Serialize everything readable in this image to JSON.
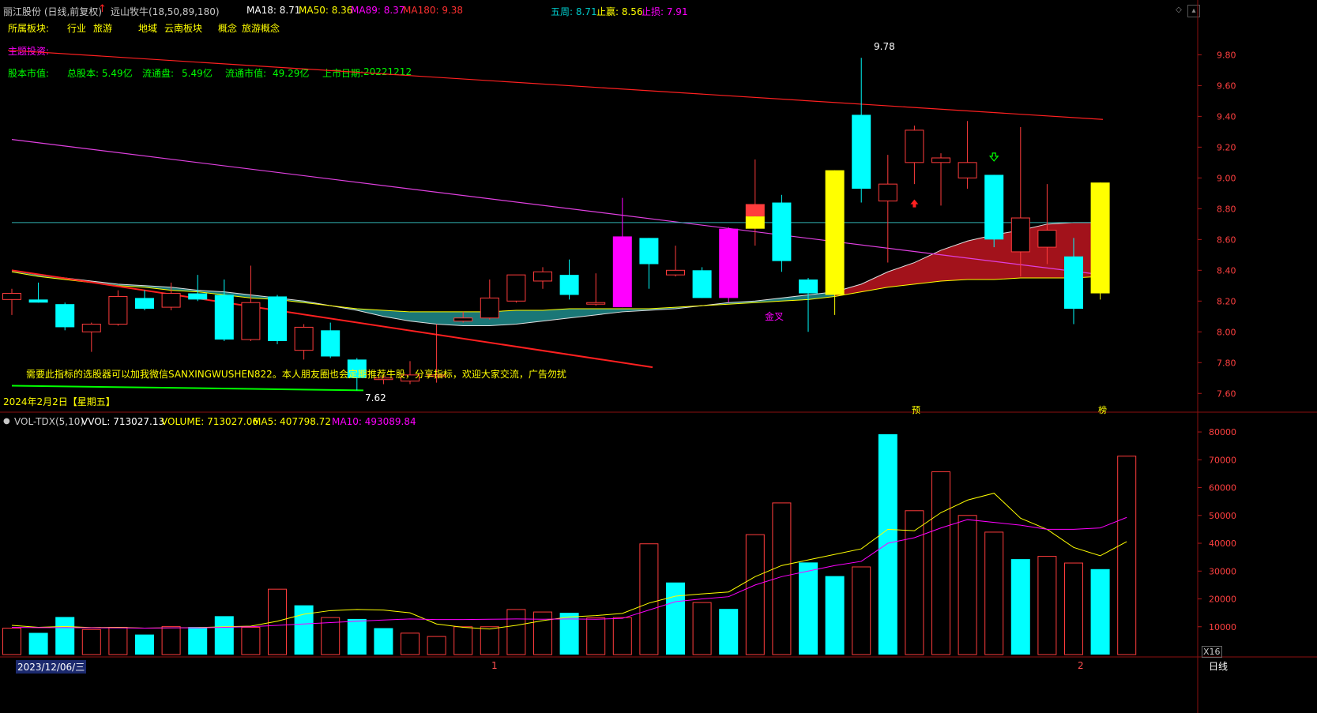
{
  "header": {
    "stock": "丽江股份 (日线,前复权)",
    "indicator": "远山牧牛(18,50,89,180)",
    "ma18": "MA18: 8.71",
    "ma50": "MA50: 8.36",
    "ma89": "MA89: 8.37",
    "ma180": "MA180: 9.38",
    "wuzhou": "五周: 8.71",
    "zhiying": "止赢: 8.56",
    "zhisun": "止损: 7.91"
  },
  "info": {
    "sector_label": "所属板块:",
    "industry_label": "行业",
    "industry": "旅游",
    "region_label": "地域",
    "region": "云南板块",
    "concept_label": "概念",
    "concept": "旅游概念",
    "theme_label": "主题投资:",
    "equity_label": "股本市值:",
    "total_shares": "总股本: 5.49亿",
    "float_shares_label": "流通盘:",
    "float_shares": "5.49亿",
    "float_cap_label": "流通市值:",
    "float_cap": "49.29亿",
    "listing_label": "上市日期:",
    "listing_date": "20221212"
  },
  "annotations": {
    "ad_text": "需要此指标的选股器可以加我微信SANXINGWUSHEN822。本人朋友圈也会定期推荐牛股，分享指标，欢迎大家交流，广告勿扰",
    "golden_cross": "金叉",
    "high_label": "9.78",
    "low_label": "7.62",
    "date_label": "2024年2月2日【星期五】",
    "marker_yu": "预",
    "marker_bang": "榜"
  },
  "volume_header": {
    "name": "VOL-TDX(5,10)",
    "vvol": "VVOL: 713027.13",
    "volume": "VOLUME: 713027.06",
    "ma5": "MA5: 407798.72",
    "ma10": "MA10: 493089.84"
  },
  "footer": {
    "start_date": "2023/12/06/三",
    "marker_1": "1",
    "marker_2": "2",
    "period": "日线",
    "zoom": "X16"
  },
  "colors": {
    "up": "#ff3c3c",
    "down": "#00ffff",
    "yellow": "#ffff00",
    "magenta": "#ff00ff",
    "band_up": "#b4141e",
    "band_down": "#1e8c8c"
  },
  "chart_data": [
    {
      "type": "candlestick",
      "title": "丽江股份 (日线,前复权)",
      "ylim": [
        7.55,
        9.92
      ],
      "yticks": [
        "9.80",
        "9.60",
        "9.40",
        "9.20",
        "9.00",
        "8.80",
        "8.60",
        "8.40",
        "8.20",
        "8.00",
        "7.80",
        "7.60"
      ],
      "ytick_values": [
        9.8,
        9.6,
        9.4,
        9.2,
        9.0,
        8.8,
        8.6,
        8.4,
        8.2,
        8.0,
        7.8,
        7.6
      ],
      "candles": [
        {
          "o": 8.21,
          "h": 8.28,
          "l": 8.11,
          "c": 8.25,
          "kind": "up"
        },
        {
          "o": 8.21,
          "h": 8.32,
          "l": 8.19,
          "c": 8.19,
          "kind": "down"
        },
        {
          "o": 8.18,
          "h": 8.19,
          "l": 8.01,
          "c": 8.03,
          "kind": "down"
        },
        {
          "o": 8.0,
          "h": 8.06,
          "l": 7.87,
          "c": 8.05,
          "kind": "up"
        },
        {
          "o": 8.05,
          "h": 8.27,
          "l": 8.04,
          "c": 8.23,
          "kind": "up"
        },
        {
          "o": 8.22,
          "h": 8.27,
          "l": 8.14,
          "c": 8.15,
          "kind": "down"
        },
        {
          "o": 8.16,
          "h": 8.32,
          "l": 8.14,
          "c": 8.25,
          "kind": "up"
        },
        {
          "o": 8.25,
          "h": 8.37,
          "l": 8.2,
          "c": 8.21,
          "kind": "down"
        },
        {
          "o": 8.24,
          "h": 8.34,
          "l": 7.94,
          "c": 7.95,
          "kind": "down"
        },
        {
          "o": 7.95,
          "h": 8.43,
          "l": 7.94,
          "c": 8.19,
          "kind": "up"
        },
        {
          "o": 8.23,
          "h": 8.24,
          "l": 7.92,
          "c": 7.94,
          "kind": "down"
        },
        {
          "o": 7.88,
          "h": 8.05,
          "l": 7.82,
          "c": 8.03,
          "kind": "up"
        },
        {
          "o": 8.01,
          "h": 8.06,
          "l": 7.83,
          "c": 7.84,
          "kind": "down"
        },
        {
          "o": 7.82,
          "h": 7.83,
          "l": 7.62,
          "c": 7.7,
          "kind": "down"
        },
        {
          "o": 7.69,
          "h": 7.72,
          "l": 7.66,
          "c": 7.7,
          "kind": "up"
        },
        {
          "o": 7.68,
          "h": 7.81,
          "l": 7.66,
          "c": 7.72,
          "kind": "up"
        },
        {
          "o": 7.71,
          "h": 8.05,
          "l": 7.67,
          "c": 7.72,
          "kind": "up"
        },
        {
          "o": 8.07,
          "h": 8.13,
          "l": 8.06,
          "c": 8.09,
          "kind": "up"
        },
        {
          "o": 8.09,
          "h": 8.34,
          "l": 8.08,
          "c": 8.22,
          "kind": "up"
        },
        {
          "o": 8.2,
          "h": 8.37,
          "l": 8.19,
          "c": 8.37,
          "kind": "up"
        },
        {
          "o": 8.33,
          "h": 8.42,
          "l": 8.28,
          "c": 8.39,
          "kind": "up"
        },
        {
          "o": 8.37,
          "h": 8.47,
          "l": 8.21,
          "c": 8.24,
          "kind": "down"
        },
        {
          "o": 8.18,
          "h": 8.38,
          "l": 8.17,
          "c": 8.19,
          "kind": "up"
        },
        {
          "o": 8.16,
          "h": 8.87,
          "l": 8.16,
          "c": 8.62,
          "kind": "magenta"
        },
        {
          "o": 8.61,
          "h": 8.61,
          "l": 8.28,
          "c": 8.44,
          "kind": "down"
        },
        {
          "o": 8.37,
          "h": 8.56,
          "l": 8.36,
          "c": 8.4,
          "kind": "up"
        },
        {
          "o": 8.4,
          "h": 8.42,
          "l": 8.22,
          "c": 8.22,
          "kind": "down"
        },
        {
          "o": 8.22,
          "h": 8.68,
          "l": 8.19,
          "c": 8.67,
          "kind": "magenta"
        },
        {
          "o": 8.67,
          "h": 9.12,
          "l": 8.56,
          "c": 8.83,
          "kind": "redyellow"
        },
        {
          "o": 8.84,
          "h": 8.89,
          "l": 8.39,
          "c": 8.46,
          "kind": "down"
        },
        {
          "o": 8.34,
          "h": 8.35,
          "l": 8.0,
          "c": 8.25,
          "kind": "down"
        },
        {
          "o": 8.24,
          "h": 9.05,
          "l": 8.11,
          "c": 9.05,
          "kind": "yellow"
        },
        {
          "o": 9.41,
          "h": 9.78,
          "l": 8.84,
          "c": 8.93,
          "kind": "down"
        },
        {
          "o": 8.85,
          "h": 9.15,
          "l": 8.45,
          "c": 8.96,
          "kind": "up"
        },
        {
          "o": 9.1,
          "h": 9.34,
          "l": 8.96,
          "c": 9.31,
          "kind": "up"
        },
        {
          "o": 9.1,
          "h": 9.16,
          "l": 8.82,
          "c": 9.13,
          "kind": "up"
        },
        {
          "o": 9.0,
          "h": 9.37,
          "l": 8.93,
          "c": 9.1,
          "kind": "up"
        },
        {
          "o": 9.02,
          "h": 9.02,
          "l": 8.55,
          "c": 8.6,
          "kind": "down"
        },
        {
          "o": 8.52,
          "h": 9.33,
          "l": 8.36,
          "c": 8.74,
          "kind": "up"
        },
        {
          "o": 8.66,
          "h": 8.96,
          "l": 8.44,
          "c": 8.55,
          "kind": "up"
        },
        {
          "o": 8.49,
          "h": 8.61,
          "l": 8.05,
          "c": 8.15,
          "kind": "down"
        },
        {
          "o": 8.25,
          "h": 8.97,
          "l": 8.21,
          "c": 8.97,
          "kind": "yellow"
        }
      ],
      "ma_long": [
        9.83,
        9.38
      ],
      "ma_mid": [
        9.25,
        8.37
      ],
      "flat_line": 8.71,
      "upper_band": [
        8.4,
        8.37,
        8.35,
        8.33,
        8.31,
        8.3,
        8.29,
        8.27,
        8.26,
        8.24,
        8.22,
        8.2,
        8.17,
        8.14,
        8.1,
        8.07,
        8.05,
        8.04,
        8.04,
        8.05,
        8.07,
        8.09,
        8.11,
        8.13,
        8.14,
        8.15,
        8.17,
        8.19,
        8.2,
        8.22,
        8.24,
        8.26,
        8.31,
        8.39,
        8.45,
        8.53,
        8.59,
        8.63,
        8.66,
        8.7,
        8.71,
        8.71
      ],
      "lower_band": [
        8.39,
        8.36,
        8.34,
        8.32,
        8.3,
        8.29,
        8.27,
        8.26,
        8.24,
        8.22,
        8.21,
        8.19,
        8.17,
        8.15,
        8.14,
        8.13,
        8.13,
        8.13,
        8.13,
        8.14,
        8.14,
        8.15,
        8.15,
        8.15,
        8.15,
        8.16,
        8.17,
        8.18,
        8.19,
        8.2,
        8.21,
        8.23,
        8.26,
        8.29,
        8.31,
        8.33,
        8.34,
        8.34,
        8.35,
        8.35,
        8.35,
        8.36
      ],
      "trend_red": [
        8.4,
        7.77
      ],
      "trend_green": [
        7.65,
        7.62
      ]
    },
    {
      "type": "bar",
      "title": "VOL-TDX(5,10)",
      "ylim": [
        0,
        82000
      ],
      "yticks": [
        "80000",
        "70000",
        "60000",
        "50000",
        "40000",
        "30000",
        "20000",
        "10000"
      ],
      "ytick_values": [
        80000,
        70000,
        60000,
        50000,
        40000,
        30000,
        20000,
        10000
      ],
      "values": [
        9500,
        7800,
        13500,
        9000,
        9800,
        7200,
        10100,
        9900,
        13800,
        9800,
        23500,
        17700,
        13300,
        12800,
        9500,
        7700,
        6500,
        10000,
        10000,
        16200,
        15300,
        15000,
        13200,
        13300,
        39800,
        25900,
        18700,
        16400,
        43100,
        54500,
        33100,
        28200,
        31500,
        79200,
        51700,
        65700,
        50000,
        44000,
        34300,
        35300,
        32900,
        30700,
        71300
      ],
      "kinds": [
        "up",
        "down",
        "down",
        "up",
        "up",
        "down",
        "up",
        "down",
        "down",
        "up",
        "up",
        "down",
        "up",
        "down",
        "down",
        "up",
        "up",
        "up",
        "up",
        "up",
        "up",
        "down",
        "up",
        "up",
        "up",
        "down",
        "up",
        "down",
        "up",
        "up",
        "down",
        "down",
        "up",
        "down",
        "up",
        "up",
        "up",
        "up",
        "down",
        "up",
        "up",
        "down",
        "up"
      ],
      "series": [
        {
          "name": "MA5",
          "values": [
            10500,
            9800,
            10100,
            9700,
            9800,
            9500,
            9600,
            9700,
            10000,
            10200,
            12000,
            14500,
            15800,
            16200,
            16000,
            15000,
            11000,
            9800,
            9200,
            10500,
            12200,
            13500,
            14000,
            14800,
            18500,
            21000,
            21800,
            22500,
            28000,
            32000,
            34000,
            36000,
            38000,
            45000,
            44500,
            51000,
            55500,
            58000,
            49000,
            45000,
            38500,
            35500,
            40600
          ]
        },
        {
          "name": "MA10",
          "values": [
            9800,
            9700,
            9700,
            9600,
            9600,
            9500,
            9600,
            9600,
            9800,
            10000,
            10500,
            11000,
            11500,
            12000,
            12400,
            12800,
            12600,
            12600,
            12700,
            12800,
            12700,
            12800,
            12700,
            13000,
            16000,
            19000,
            20000,
            20800,
            25000,
            28000,
            30000,
            32000,
            33500,
            40000,
            42000,
            45500,
            48500,
            47500,
            46500,
            45000,
            45000,
            45500,
            49300
          ]
        }
      ]
    }
  ]
}
